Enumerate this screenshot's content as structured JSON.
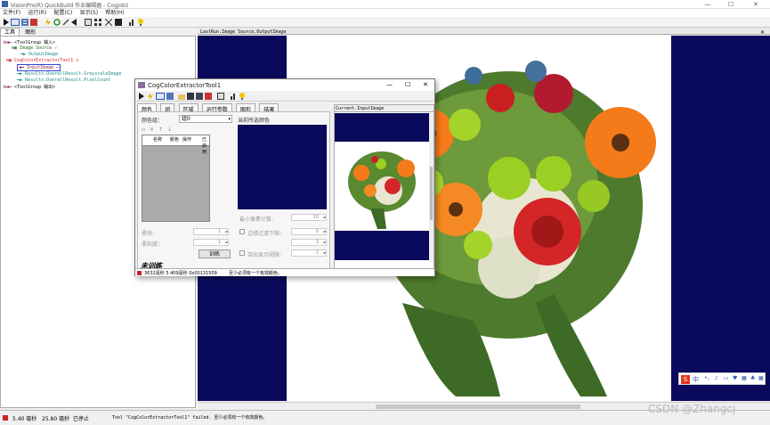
{
  "window": {
    "title": "VisionPro(R) QuickBuild 作业编辑器 - Cogjob1",
    "min": "—",
    "max": "☐",
    "close": "✕"
  },
  "menu": [
    "文件(F)",
    "运行(R)",
    "配置(C)",
    "显示(S)",
    "帮助(H)"
  ],
  "left_tabs": [
    "工具",
    "图形"
  ],
  "tree": [
    {
      "text": "<ToolGroup 输入>",
      "kind": "in"
    },
    {
      "text": "Image Source",
      "kind": "node"
    },
    {
      "text": "OutputImage",
      "kind": "out"
    },
    {
      "text": "CogColorExtractorTool1",
      "kind": "node"
    },
    {
      "text": "InputImage",
      "kind": "in"
    },
    {
      "text": "Results.OverallResult.GreyscaleImage",
      "kind": "out"
    },
    {
      "text": "Results.OverallResult.PixelCount",
      "kind": "out"
    },
    {
      "text": "<ToolGroup 输出>",
      "kind": "in"
    }
  ],
  "image_header": "LastRun.Image Source.OutputImage",
  "status": {
    "time1": "5.40 毫秒",
    "time2": "25.80 毫秒",
    "state": "已停止",
    "message": "Tool \"CogColorExtractorTool1\" failed. 至少必须有一个有效颜色。"
  },
  "dialog": {
    "title": "CogColorExtractorTool1",
    "tabs": [
      "颜色",
      "组",
      "区域",
      "运行参数",
      "图形",
      "结果"
    ],
    "color_group_label": "颜色组：",
    "color_group_value": "组0",
    "current_color_label": "当前所选颜色",
    "table_headers": [
      "名称",
      "颜色",
      "操作",
      "已启用"
    ],
    "matte_label": "柔除：",
    "soft_label": "柔和度：",
    "matte_value": "1",
    "soft_value": "1",
    "min_pixel_label": "最小像素计数：",
    "min_pixel_value": "10",
    "dilation_label": "边缘过滤下限：",
    "dilation_value": "0",
    "highlight_label": "突出显示阈限：",
    "highlight_value": "1",
    "gap_value": "1",
    "train_button": "训练",
    "untrained_label": "未训练",
    "right_header": "Current.InputImage",
    "status_time": "3632毫秒 5.409毫秒 0x00131509",
    "status_msg": "至少必须有一个有效颜色。"
  },
  "ime_label": "中",
  "watermark": "CSDN @Zhangcj"
}
